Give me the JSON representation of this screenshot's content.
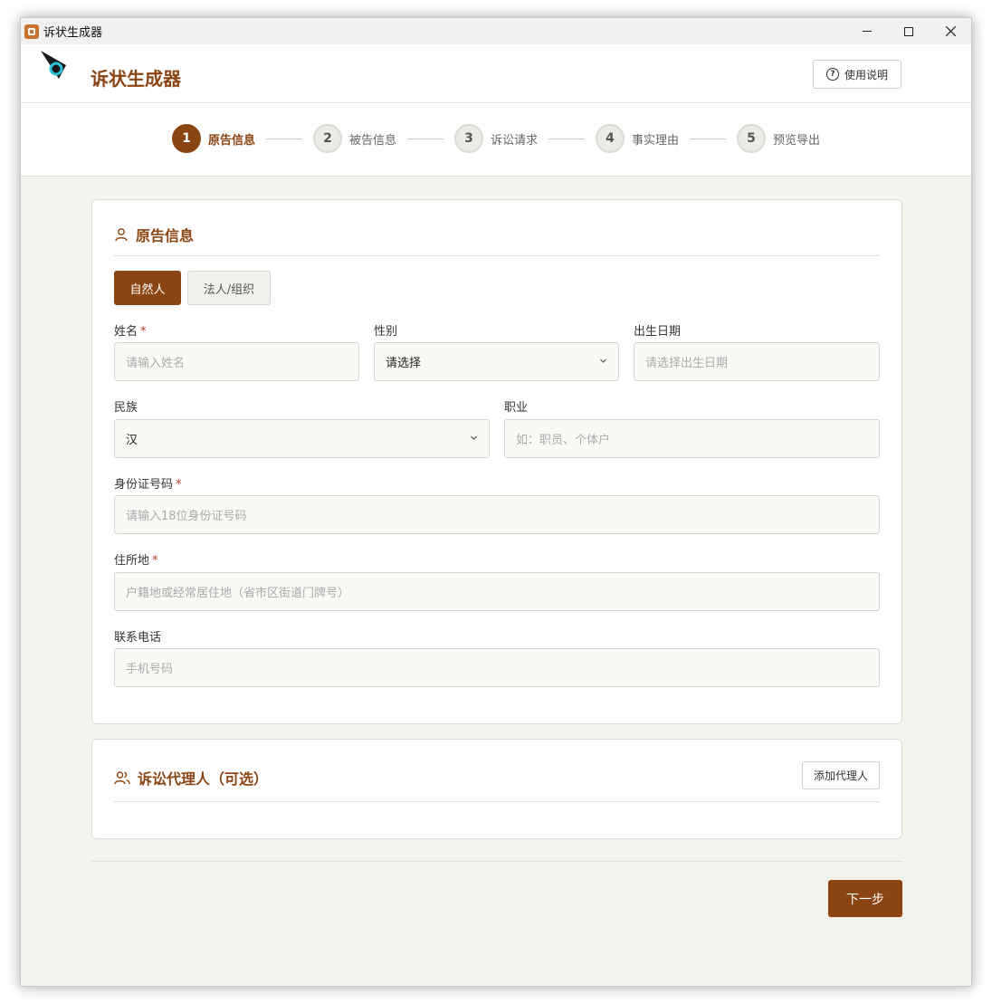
{
  "window": {
    "title": "诉状生成器"
  },
  "header": {
    "brand": "诉状生成器",
    "help_label": "使用说明"
  },
  "steps": [
    {
      "num": "1",
      "label": "原告信息",
      "active": true
    },
    {
      "num": "2",
      "label": "被告信息",
      "active": false
    },
    {
      "num": "3",
      "label": "诉讼请求",
      "active": false
    },
    {
      "num": "4",
      "label": "事实理由",
      "active": false
    },
    {
      "num": "5",
      "label": "预览导出",
      "active": false
    }
  ],
  "plaintiff_card": {
    "title": "原告信息",
    "type_options": [
      "自然人",
      "法人/组织"
    ],
    "selected_type": "自然人",
    "fields": {
      "name": {
        "label": "姓名",
        "required_mark": "*",
        "placeholder": "请输入姓名"
      },
      "gender": {
        "label": "性别",
        "value": "请选择"
      },
      "birth": {
        "label": "出生日期",
        "placeholder": "请选择出生日期"
      },
      "ethnicity": {
        "label": "民族",
        "value": "汉"
      },
      "occupation": {
        "label": "职业",
        "placeholder": "如：职员、个体户"
      },
      "id_number": {
        "label": "身份证号码",
        "required_mark": "*",
        "placeholder": "请输入18位身份证号码"
      },
      "address": {
        "label": "住所地",
        "required_mark": "*",
        "placeholder": "户籍地或经常居住地（省市区街道门牌号）"
      },
      "phone": {
        "label": "联系电话",
        "placeholder": "手机号码"
      }
    }
  },
  "agent_card": {
    "title": "诉讼代理人（可选）",
    "add_label": "添加代理人"
  },
  "footer": {
    "next_label": "下一步"
  },
  "colors": {
    "accent": "#8b4513",
    "background": "#f4f3ee"
  }
}
